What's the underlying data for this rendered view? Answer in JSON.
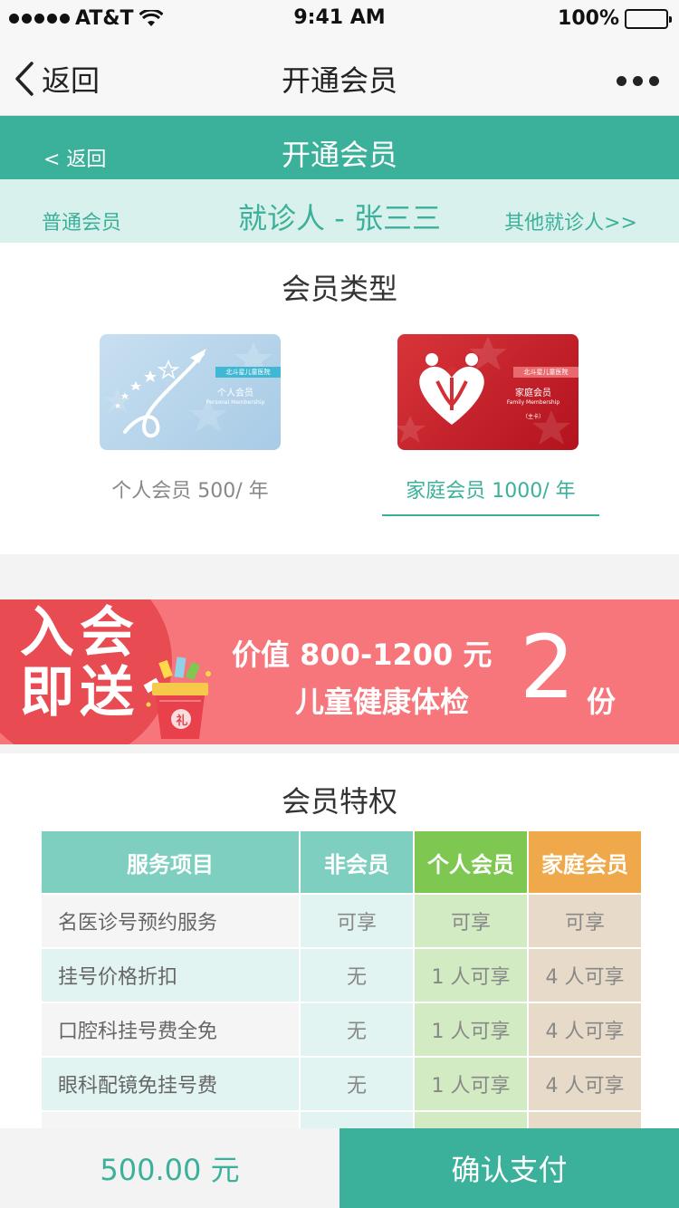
{
  "status_bar": {
    "carrier": "AT&T",
    "time": "9:41 AM",
    "battery": "100%"
  },
  "nav": {
    "back_label": "返回",
    "title": "开通会员"
  },
  "header": {
    "back_label": "< 返回",
    "title": "开通会员"
  },
  "patient": {
    "level": "普通会员",
    "name": "就诊人 - 张三三",
    "other": "其他就诊人>>"
  },
  "member_type": {
    "title": "会员类型",
    "cards": [
      {
        "hospital": "北斗星儿童医院",
        "name": "个人会员",
        "sub": "Personal Membership",
        "extra": "",
        "caption": "个人会员 500/ 年"
      },
      {
        "hospital": "北斗星儿童医院",
        "name": "家庭会员",
        "sub": "Family Membership",
        "extra": "（主卡）",
        "caption": "家庭会员 1000/ 年"
      }
    ],
    "selected_index": 1
  },
  "promo": {
    "big_line1": "入会",
    "big_line2": "即送",
    "gift_label": "礼",
    "line1": "价值 800-1200 元",
    "line2": "儿童健康体检",
    "count": "2",
    "unit": "份"
  },
  "privileges": {
    "title": "会员特权",
    "headers": [
      "服务项目",
      "非会员",
      "个人会员",
      "家庭会员"
    ],
    "rows": [
      [
        "名医诊号预约服务",
        "可享",
        "可享",
        "可享"
      ],
      [
        "挂号价格折扣",
        "无",
        "1 人可享",
        "4 人可享"
      ],
      [
        "口腔科挂号费全免",
        "无",
        "1 人可享",
        "4 人可享"
      ],
      [
        "眼科配镜免挂号费",
        "无",
        "1 人可享",
        "4 人可享"
      ]
    ]
  },
  "bottom": {
    "price": "500.00 元",
    "pay_label": "确认支付"
  },
  "colors": {
    "teal": "#3bb09a",
    "teal_light": "#d9f1ec",
    "promo_red": "#f7767b",
    "promo_dark": "#e94b53",
    "personal_green": "#7ec852",
    "family_orange": "#efa94a"
  }
}
